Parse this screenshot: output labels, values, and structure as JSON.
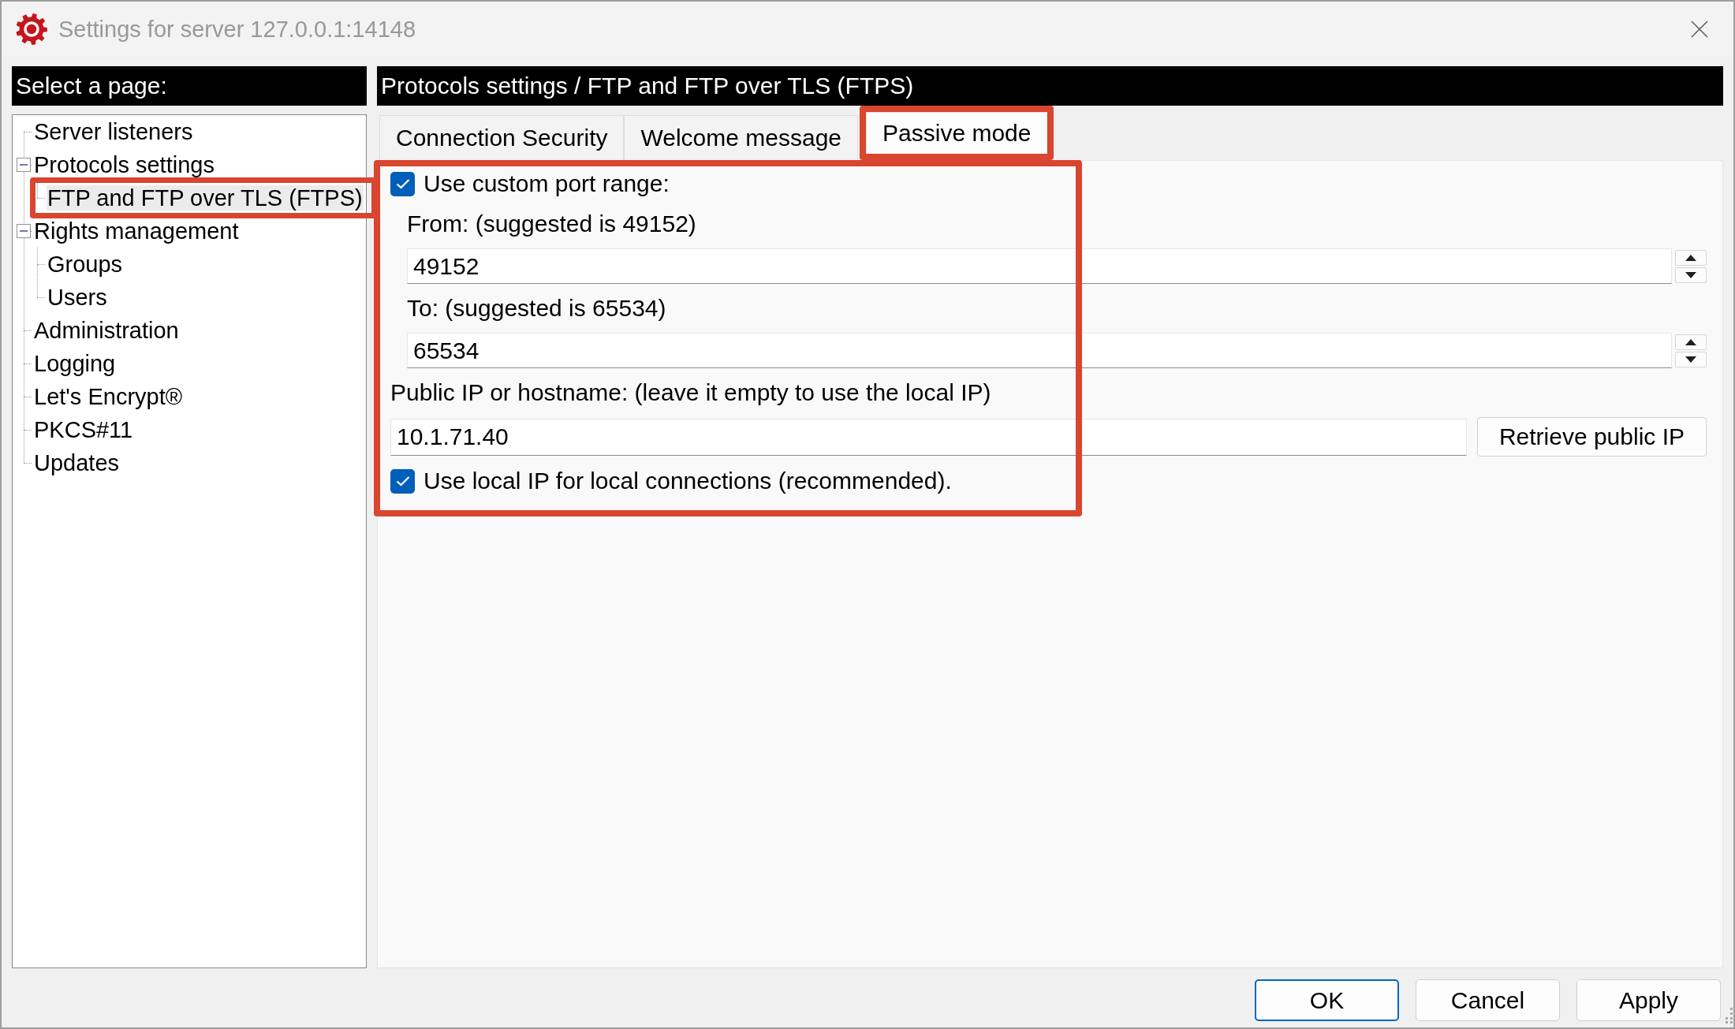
{
  "window": {
    "title": "Settings for server 127.0.0.1:14148"
  },
  "sidebar": {
    "header": "Select a page:",
    "tree": [
      {
        "label": "Server listeners",
        "selected": false,
        "highlighted": false
      },
      {
        "label": "Protocols settings",
        "selected": false,
        "highlighted": false,
        "expanded": true,
        "children": [
          {
            "label": "FTP and FTP over TLS (FTPS)",
            "selected": true,
            "highlighted": true
          }
        ]
      },
      {
        "label": "Rights management",
        "selected": false,
        "highlighted": false,
        "expanded": true,
        "children": [
          {
            "label": "Groups",
            "selected": false,
            "highlighted": false
          },
          {
            "label": "Users",
            "selected": false,
            "highlighted": false
          }
        ]
      },
      {
        "label": "Administration",
        "selected": false,
        "highlighted": false
      },
      {
        "label": "Logging",
        "selected": false,
        "highlighted": false
      },
      {
        "label": "Let's Encrypt®",
        "selected": false,
        "highlighted": false
      },
      {
        "label": "PKCS#11",
        "selected": false,
        "highlighted": false
      },
      {
        "label": "Updates",
        "selected": false,
        "highlighted": false
      }
    ]
  },
  "page": {
    "header": "Protocols settings / FTP and FTP over TLS (FTPS)",
    "tabs": [
      {
        "label": "Connection Security",
        "selected": false,
        "highlighted": false
      },
      {
        "label": "Welcome message",
        "selected": false,
        "highlighted": false
      },
      {
        "label": "Passive mode",
        "selected": true,
        "highlighted": true
      }
    ],
    "passive_mode": {
      "highlighted": true,
      "controls": [
        {
          "kind": "checkbox",
          "label": "Use custom port range:",
          "checked": true
        },
        {
          "kind": "number",
          "label": "From: (suggested is 49152)",
          "value": "49152"
        },
        {
          "kind": "number",
          "label": "To: (suggested is 65534)",
          "value": "65534"
        },
        {
          "kind": "text",
          "label": "Public IP or hostname: (leave it empty to use the local IP)",
          "value": "10.1.71.40",
          "button": "Retrieve public IP"
        },
        {
          "kind": "checkbox",
          "label": "Use local IP for local connections (recommended).",
          "checked": true
        }
      ]
    }
  },
  "buttons": [
    {
      "label": "OK",
      "default": true
    },
    {
      "label": "Cancel",
      "default": false
    },
    {
      "label": "Apply",
      "default": false
    }
  ]
}
